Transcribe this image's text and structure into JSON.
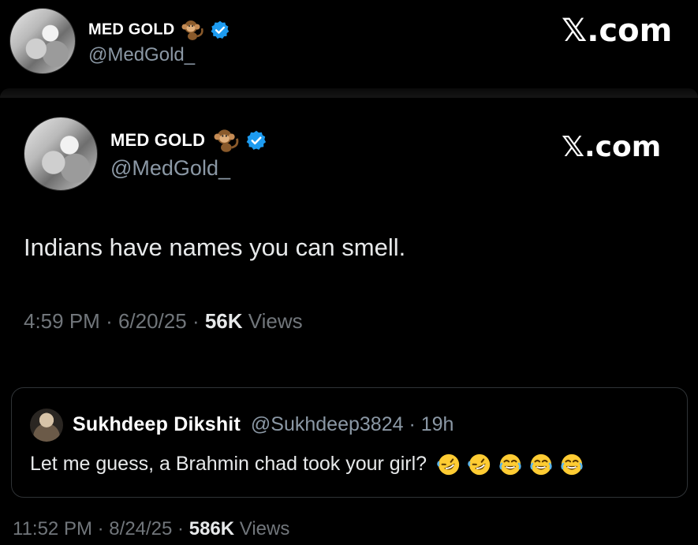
{
  "outer_header": {
    "name": "MED GOLD",
    "handle": "@MedGold_",
    "brand": "𝕏.com"
  },
  "main_tweet": {
    "name": "MED GOLD",
    "handle": "@MedGold_",
    "brand": "𝕏.com",
    "text": "Indians have names you can smell.",
    "time": "4:59 PM",
    "date": "6/20/25",
    "views_count": "56K",
    "views_label": "Views"
  },
  "quote": {
    "name": "Sukhdeep Dikshit",
    "handle": "@Sukhdeep3824",
    "age": "19h",
    "text": "Let me guess, a Brahmin chad took your girl?",
    "emojis": [
      "rolling-on-floor-laughing",
      "rolling-on-floor-laughing",
      "face-with-tears-of-joy",
      "face-with-tears-of-joy",
      "face-with-tears-of-joy"
    ]
  },
  "footer": {
    "time": "11:52 PM",
    "date": "8/24/25",
    "views_count": "586K",
    "views_label": "Views"
  },
  "colors": {
    "background": "#000000",
    "verified_blue": "#1d9bf0",
    "muted_text": "#71767b",
    "border": "#2f3336"
  }
}
